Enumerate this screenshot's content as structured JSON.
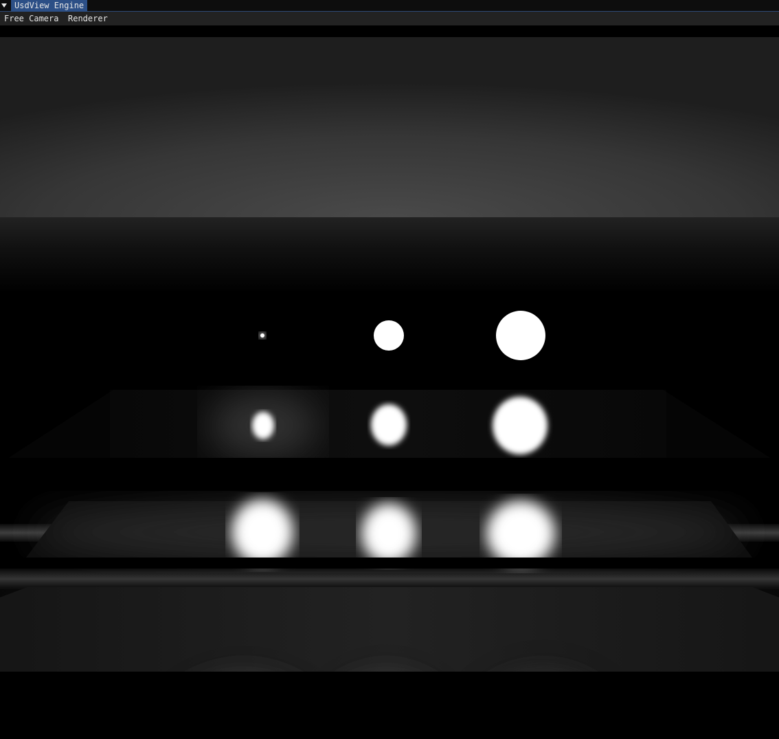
{
  "window": {
    "title": "UsdView Engine",
    "collapse_icon": "triangle-down-icon",
    "accent_color": "#2c4f86"
  },
  "menu": {
    "items": [
      {
        "label": "Free Camera"
      },
      {
        "label": "Renderer"
      }
    ]
  },
  "viewport": {
    "content": "rendered-scene",
    "background_color": "#000000"
  }
}
